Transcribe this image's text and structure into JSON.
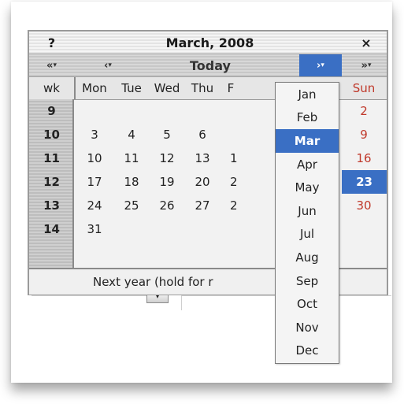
{
  "calendar": {
    "help": "?",
    "title": "March, 2008",
    "close": "×",
    "nav": {
      "prev_year": "«",
      "prev_month": "‹",
      "today": "Today",
      "next_month": "›",
      "next_year": "»",
      "dropdown_marker": "▾"
    },
    "day_headers": [
      "wk",
      "Mon",
      "Tue",
      "Wed",
      "Thu",
      "F",
      "Sun"
    ],
    "weeks": [
      {
        "wk": "9",
        "days": [
          "",
          "",
          "",
          "",
          "",
          "2"
        ]
      },
      {
        "wk": "10",
        "days": [
          "3",
          "4",
          "5",
          "6",
          "",
          "9"
        ]
      },
      {
        "wk": "11",
        "days": [
          "10",
          "11",
          "12",
          "13",
          "1",
          "16"
        ]
      },
      {
        "wk": "12",
        "days": [
          "17",
          "18",
          "19",
          "20",
          "2",
          "23"
        ]
      },
      {
        "wk": "13",
        "days": [
          "24",
          "25",
          "26",
          "27",
          "2",
          "30"
        ]
      },
      {
        "wk": "14",
        "days": [
          "31",
          "",
          "",
          "",
          "",
          ""
        ]
      }
    ],
    "today_day": "23",
    "footer": "Next year (hold for r",
    "sunday_color": "#c0392b",
    "accent_color": "#3a6fc4"
  },
  "month_menu": {
    "items": [
      "Jan",
      "Feb",
      "Mar",
      "Apr",
      "May",
      "Jun",
      "Jul",
      "Aug",
      "Sep",
      "Oct",
      "Nov",
      "Dec"
    ],
    "selected": "Mar"
  }
}
